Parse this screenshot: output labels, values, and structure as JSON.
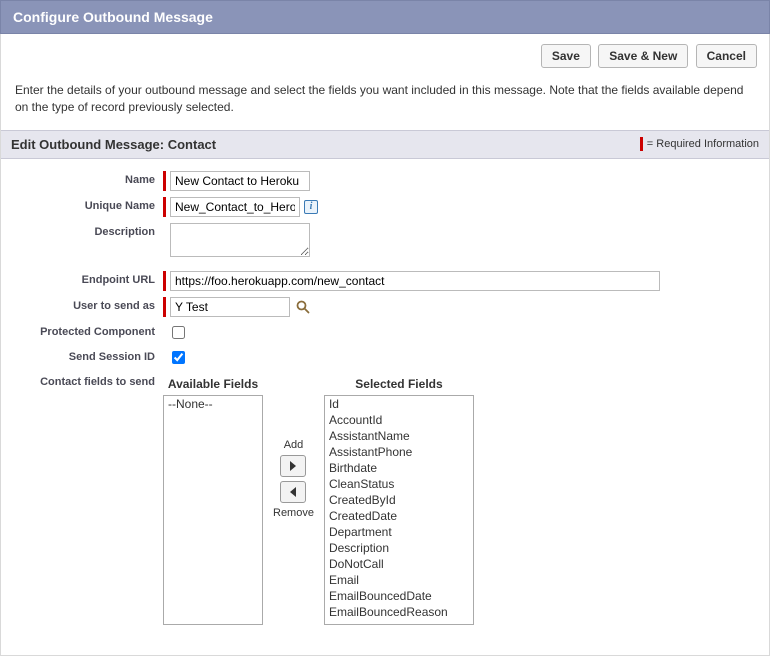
{
  "header": {
    "title": "Configure Outbound Message"
  },
  "buttons": {
    "save": "Save",
    "save_new": "Save & New",
    "cancel": "Cancel"
  },
  "intro": "Enter the details of your outbound message and select the fields you want included in this message. Note that the fields available depend on the type of record previously selected.",
  "section": {
    "title": "Edit Outbound Message: Contact",
    "required_label": "= Required Information"
  },
  "labels": {
    "name": "Name",
    "unique_name": "Unique Name",
    "description": "Description",
    "endpoint_url": "Endpoint URL",
    "user_to_send_as": "User to send as",
    "protected_component": "Protected Component",
    "send_session_id": "Send Session ID",
    "contact_fields": "Contact fields to send",
    "available_fields": "Available Fields",
    "selected_fields": "Selected Fields",
    "add": "Add",
    "remove": "Remove"
  },
  "values": {
    "name": "New Contact to Heroku",
    "unique_name": "New_Contact_to_Heroku",
    "description": "",
    "endpoint_url": "https://foo.herokuapp.com/new_contact",
    "user_to_send_as": "Y Test",
    "protected_component": false,
    "send_session_id": true
  },
  "available_fields": [
    "--None--"
  ],
  "selected_fields": [
    "Id",
    "AccountId",
    "AssistantName",
    "AssistantPhone",
    "Birthdate",
    "CleanStatus",
    "CreatedById",
    "CreatedDate",
    "Department",
    "Description",
    "DoNotCall",
    "Email",
    "EmailBouncedDate",
    "EmailBouncedReason"
  ]
}
